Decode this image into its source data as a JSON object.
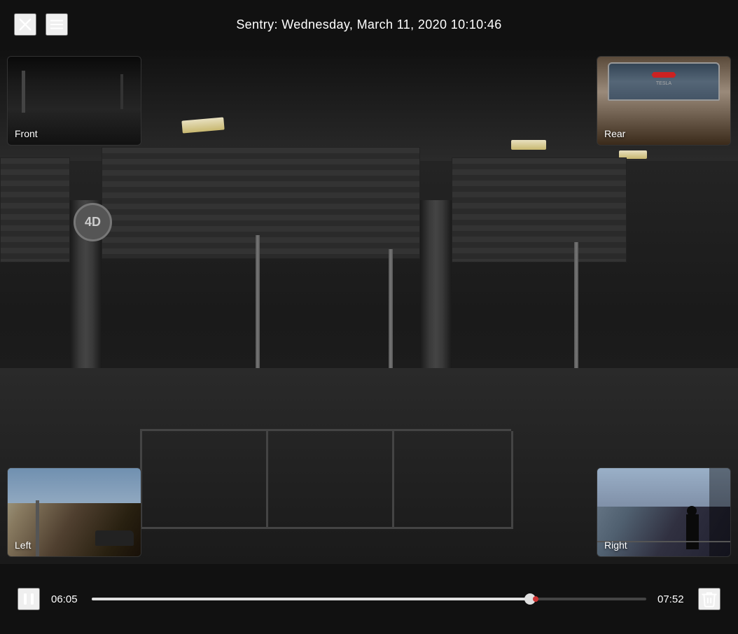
{
  "header": {
    "title": "Sentry: Wednesday, March 11, 2020 10:10:46",
    "close_label": "close",
    "menu_label": "menu"
  },
  "cameras": {
    "front": {
      "label": "Front"
    },
    "rear": {
      "label": "Rear"
    },
    "left": {
      "label": "Left"
    },
    "right": {
      "label": "Right"
    }
  },
  "controls": {
    "current_time": "06:05",
    "total_time": "07:52",
    "progress_percent": 79,
    "play_pause": "pause",
    "delete_label": "delete"
  }
}
